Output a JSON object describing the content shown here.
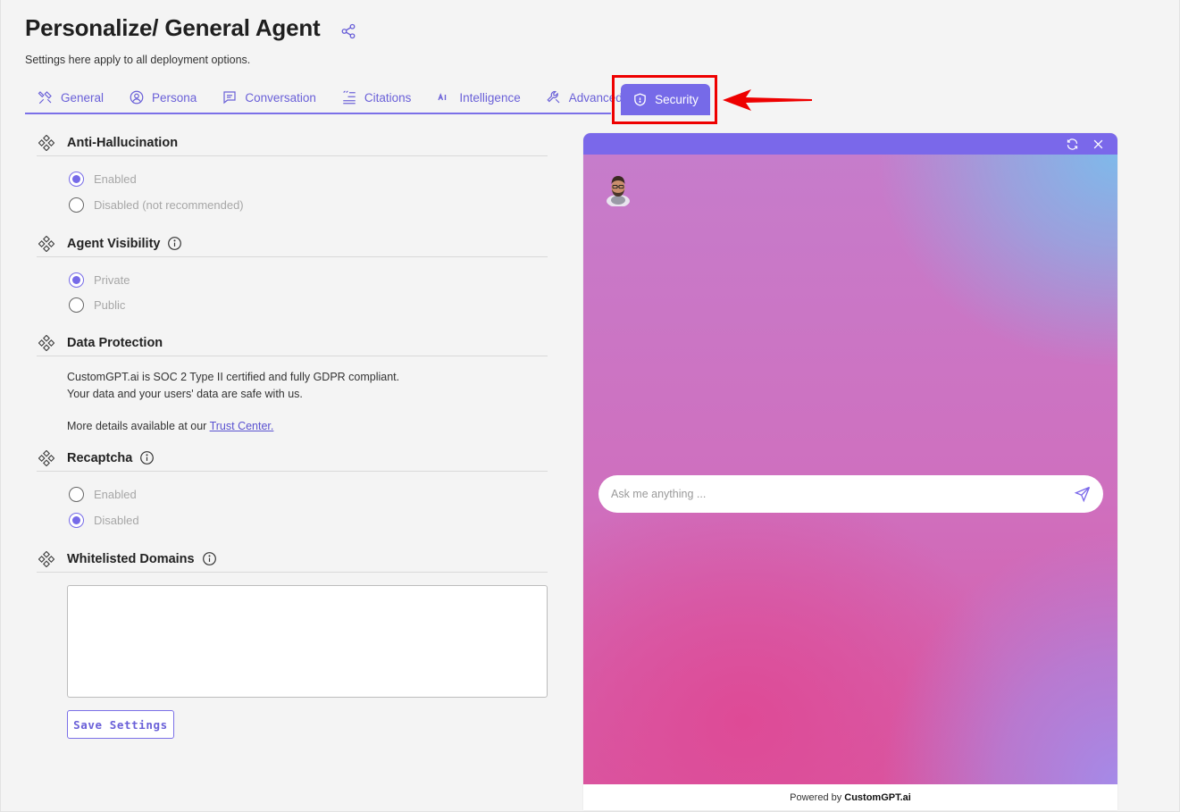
{
  "header": {
    "title": "Personalize/ General Agent",
    "subtitle": "Settings here apply to all deployment options."
  },
  "tabs": [
    {
      "label": "General",
      "icon": "tools-icon"
    },
    {
      "label": "Persona",
      "icon": "user-circle-icon"
    },
    {
      "label": "Conversation",
      "icon": "chat-bubble-icon"
    },
    {
      "label": "Citations",
      "icon": "quote-list-icon"
    },
    {
      "label": "Intelligence",
      "icon": "ai-icon"
    },
    {
      "label": "Advanced",
      "icon": "wrench-icon"
    },
    {
      "label": "Security",
      "icon": "shield-icon",
      "active": true
    }
  ],
  "sections": {
    "anti_hallucination": {
      "title": "Anti-Hallucination",
      "options": [
        "Enabled",
        "Disabled (not recommended)"
      ],
      "selected": "Enabled"
    },
    "agent_visibility": {
      "title": "Agent Visibility",
      "options": [
        "Private",
        "Public"
      ],
      "selected": "Private"
    },
    "data_protection": {
      "title": "Data Protection",
      "line1": "CustomGPT.ai is SOC 2 Type II certified and fully GDPR compliant.",
      "line2": "Your data and your users' data are safe with us.",
      "more_prefix": "More details available at our",
      "link": "Trust Center."
    },
    "recaptcha": {
      "title": "Recaptcha",
      "options": [
        "Enabled",
        "Disabled"
      ],
      "selected": "Disabled"
    },
    "whitelisted_domains": {
      "title": "Whitelisted Domains",
      "value": ""
    }
  },
  "save_label": "Save Settings",
  "chat_preview": {
    "placeholder": "Ask me anything ...",
    "powered_prefix": "Powered by",
    "powered_brand": "CustomGPT.ai"
  },
  "colors": {
    "accent": "#766ae8",
    "highlight": "#ee0000"
  }
}
